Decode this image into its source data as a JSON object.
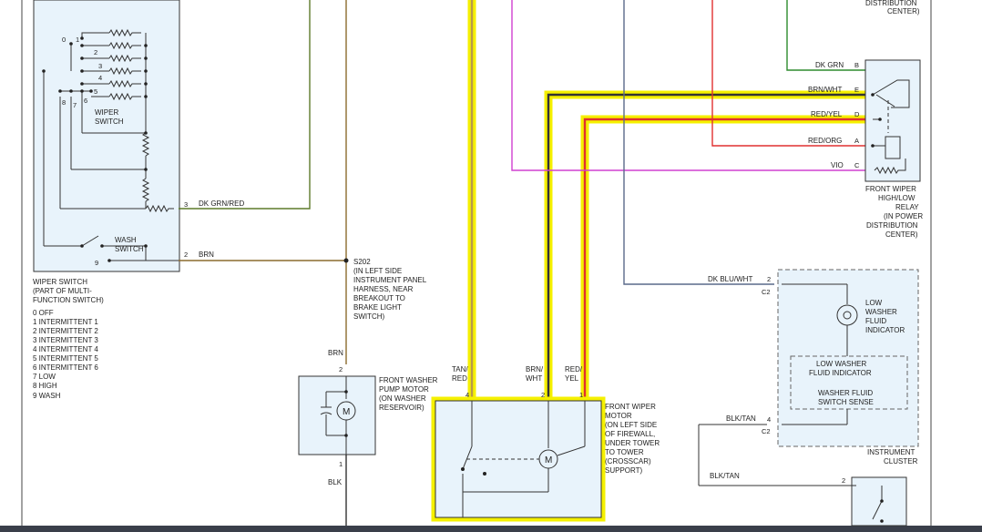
{
  "wiper_switch": {
    "title": "WIPER SWITCH",
    "caption": [
      "WIPER SWITCH",
      "(PART OF MULTI-",
      "FUNCTION SWITCH)"
    ],
    "positions": [
      "0   OFF",
      "1   INTERMITTENT 1",
      "2   INTERMITTENT 2",
      "3   INTERMITTENT 3",
      "4   INTERMITTENT 4",
      "5   INTERMITTENT 5",
      "6   INTERMITTENT 6",
      "7   LOW",
      "8   HIGH",
      "9   WASH"
    ],
    "inner_label": [
      "WIPER",
      "SWITCH"
    ],
    "wash_label": [
      "WASH",
      "SWITCH"
    ],
    "contacts": [
      "0",
      "1",
      "2",
      "3",
      "4",
      "5",
      "8",
      "7",
      "6",
      "9"
    ],
    "pin_3": "3",
    "pin_2": "2"
  },
  "wires": {
    "dk_grn_red": "DK GRN/RED",
    "brn": "BRN",
    "brn_vertical": "BRN",
    "blk": "BLK",
    "tan_red": [
      "TAN/",
      "RED"
    ],
    "brn_wht": [
      "BRN/",
      "WHT"
    ],
    "red_yel": [
      "RED/",
      "YEL"
    ],
    "dk_blu_wht": "DK BLU/WHT",
    "blk_tan": "BLK/TAN",
    "blk_tan_2": "BLK/TAN"
  },
  "splice": {
    "id": "S202",
    "desc": [
      "(IN LEFT SIDE",
      "INSTRUMENT PANEL",
      "HARNESS, NEAR",
      "BREAKOUT TO",
      "BRAKE LIGHT",
      "SWITCH)"
    ]
  },
  "washer_motor": {
    "desc": [
      "FRONT WASHER",
      "PUMP MOTOR",
      "(ON WASHER",
      "RESERVOIR)"
    ],
    "pin_top": "2",
    "pin_bottom": "1",
    "symbol": "M"
  },
  "wiper_motor": {
    "desc": [
      "FRONT WIPER",
      "MOTOR",
      "(ON LEFT SIDE",
      "OF FIREWALL,",
      "UNDER TOWER",
      "TO TOWER",
      "(CROSSCAR)",
      "SUPPORT)"
    ],
    "pins": [
      "4",
      "2",
      "1"
    ],
    "symbol": "M"
  },
  "relay": {
    "top_caption": [
      "DISTRIBUTION",
      "CENTER)"
    ],
    "desc": [
      "FRONT WIPER",
      "HIGH/LOW",
      "RELAY",
      "(IN POWER",
      "DISTRIBUTION",
      "CENTER)"
    ],
    "pins": [
      {
        "wire": "DK GRN",
        "pin": "B"
      },
      {
        "wire": "BRN/WHT",
        "pin": "E"
      },
      {
        "wire": "RED/YEL",
        "pin": "D"
      },
      {
        "wire": "RED/ORG",
        "pin": "A"
      },
      {
        "wire": "VIO",
        "pin": "C"
      }
    ]
  },
  "cluster": {
    "indicator_label": [
      "LOW",
      "WASHER",
      "FLUID",
      "INDICATOR"
    ],
    "inner_box": [
      "LOW WASHER",
      "FLUID INDICATOR",
      "",
      "WASHER FLUID",
      "SWITCH SENSE"
    ],
    "desc": [
      "INSTRUMENT",
      "CLUSTER"
    ],
    "pin_2": "2",
    "conn_2": "C2",
    "pin_4": "4",
    "conn_4": "C2"
  },
  "bottom_right": {
    "pin": "2"
  },
  "colors": {
    "highlight": "#f5f000",
    "brn_wire": "#8b6b2e",
    "grn_wire": "#2e8b2e",
    "red_wire": "#e03030",
    "vio_wire": "#d040d0",
    "blu_wire": "#5a6a8a",
    "box_fill": "#e8f3fb"
  }
}
